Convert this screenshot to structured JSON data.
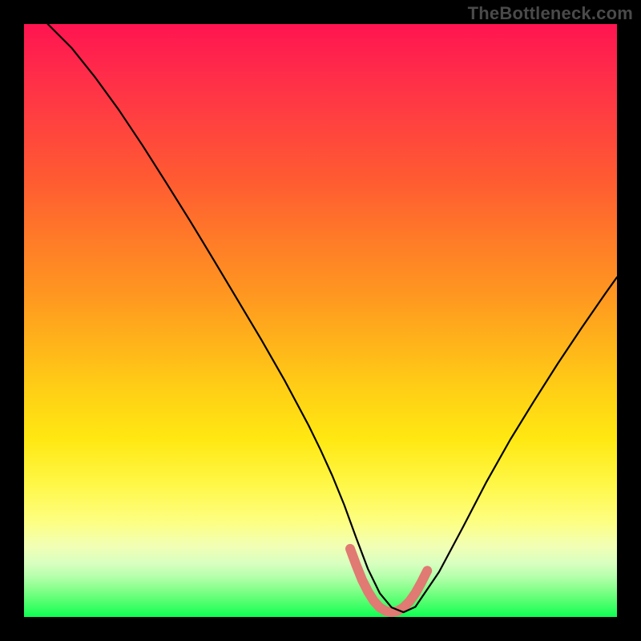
{
  "watermark": "TheBottleneck.com",
  "colors": {
    "frame": "#000000",
    "curve": "#000000",
    "highlight": "#e07a72",
    "gradient_top": "#ff1450",
    "gradient_mid": "#ffd015",
    "gradient_bottom": "#0bff52"
  },
  "chart_data": {
    "type": "line",
    "title": "",
    "xlabel": "",
    "ylabel": "",
    "xlim": [
      0,
      100
    ],
    "ylim": [
      0,
      100
    ],
    "series": [
      {
        "name": "bottleneck-curve",
        "x": [
          4,
          8,
          12,
          16,
          20,
          24,
          28,
          32,
          36,
          40,
          44,
          48,
          50,
          52,
          54,
          56,
          58,
          60,
          62,
          64,
          66,
          70,
          74,
          78,
          82,
          86,
          90,
          94,
          98,
          100
        ],
        "values": [
          100,
          96,
          91,
          85.5,
          79.5,
          73.2,
          66.8,
          60.2,
          53.5,
          46.8,
          39.8,
          32.3,
          28.2,
          23.8,
          18.9,
          13.4,
          8.1,
          4.0,
          1.6,
          0.8,
          1.7,
          7.6,
          15.1,
          22.8,
          29.9,
          36.4,
          42.7,
          48.7,
          54.5,
          57.3
        ]
      },
      {
        "name": "min-highlight",
        "x": [
          55,
          56,
          57,
          58,
          59,
          60,
          61,
          62,
          63,
          64,
          65,
          66,
          67,
          68
        ],
        "values": [
          11.5,
          8.8,
          6.3,
          4.3,
          2.7,
          1.6,
          1.0,
          0.8,
          1.0,
          1.6,
          2.6,
          4.0,
          5.8,
          7.8
        ]
      }
    ],
    "highlight_color": "#e07a72",
    "curve_color": "#000000",
    "background": "vertical-spectrum-gradient"
  }
}
